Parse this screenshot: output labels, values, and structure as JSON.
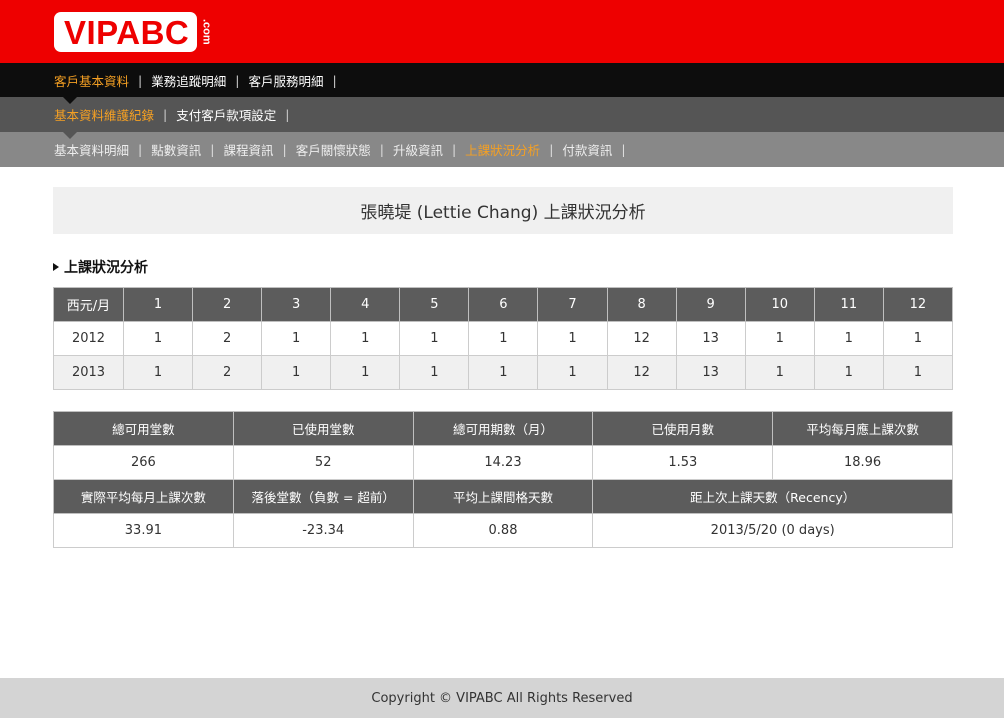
{
  "logo": {
    "text": "VIPABC",
    "suffix": ".com"
  },
  "nav_primary": [
    {
      "label": "客戶基本資料",
      "active": true
    },
    {
      "label": "業務追蹤明細",
      "active": false
    },
    {
      "label": "客戶服務明細",
      "active": false
    }
  ],
  "nav_secondary": [
    {
      "label": "基本資料維護紀錄",
      "active": true
    },
    {
      "label": "支付客戶款項設定",
      "active": false
    }
  ],
  "nav_tertiary": [
    {
      "label": "基本資料明細",
      "active": false
    },
    {
      "label": "點數資訊",
      "active": false
    },
    {
      "label": "課程資訊",
      "active": false
    },
    {
      "label": "客戶關懷狀態",
      "active": false
    },
    {
      "label": "升級資訊",
      "active": false
    },
    {
      "label": "上課狀況分析",
      "active": true
    },
    {
      "label": "付款資訊",
      "active": false
    }
  ],
  "separator": "|",
  "page_title": "張曉堤 (Lettie Chang) 上課狀況分析",
  "section_title": "上課狀況分析",
  "monthly_table": {
    "headers": [
      "西元/月",
      "1",
      "2",
      "3",
      "4",
      "5",
      "6",
      "7",
      "8",
      "9",
      "10",
      "11",
      "12"
    ],
    "rows": [
      [
        "2012",
        "1",
        "2",
        "1",
        "1",
        "1",
        "1",
        "1",
        "12",
        "13",
        "1",
        "1",
        "1"
      ],
      [
        "2013",
        "1",
        "2",
        "1",
        "1",
        "1",
        "1",
        "1",
        "12",
        "13",
        "1",
        "1",
        "1"
      ]
    ]
  },
  "summary": {
    "row1_headers": [
      "總可用堂數",
      "已使用堂數",
      "總可用期數（月）",
      "已使用月數",
      "平均每月應上課次數"
    ],
    "row1_values": [
      "266",
      "52",
      "14.23",
      "1.53",
      "18.96"
    ],
    "row2_headers": [
      "實際平均每月上課次數",
      "落後堂數（負數 = 超前）",
      "平均上課間格天數",
      "距上次上課天數（Recency）"
    ],
    "row2_values": [
      "33.91",
      "-23.34",
      "0.88",
      "2013/5/20 (0 days)"
    ]
  },
  "footer": "Copyright © VIPABC All Rights Reserved",
  "colors": {
    "brand_red": "#ee0000",
    "active_orange": "#f5a023",
    "header_gray": "#5c5c5c"
  }
}
